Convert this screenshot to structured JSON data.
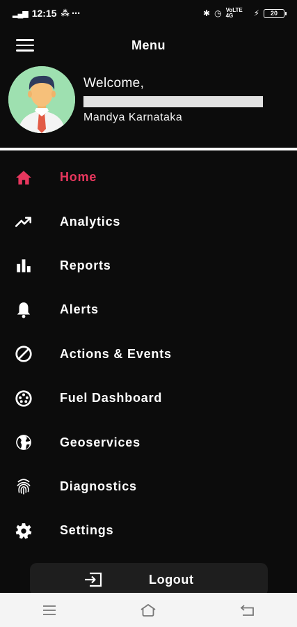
{
  "status_bar": {
    "signal": "4G",
    "time": "12:15",
    "extra": "⁂ ⋯",
    "network": "VoLTE 4G",
    "battery": "20"
  },
  "header": {
    "title": "Menu"
  },
  "profile": {
    "welcome": "Welcome,",
    "location": "Mandya Karnataka"
  },
  "nav": {
    "items": [
      {
        "label": "Home",
        "icon": "home-icon",
        "active": true
      },
      {
        "label": "Analytics",
        "icon": "trending-up-icon"
      },
      {
        "label": "Reports",
        "icon": "bar-chart-icon"
      },
      {
        "label": "Alerts",
        "icon": "bell-icon"
      },
      {
        "label": "Actions & Events",
        "icon": "block-icon"
      },
      {
        "label": "Fuel Dashboard",
        "icon": "gauge-icon"
      },
      {
        "label": "Geoservices",
        "icon": "globe-icon"
      },
      {
        "label": "Diagnostics",
        "icon": "fingerprint-icon"
      },
      {
        "label": "Settings",
        "icon": "gear-icon"
      }
    ]
  },
  "logout": {
    "label": "Logout"
  },
  "colors": {
    "background": "#0c0c0c",
    "accent": "#e8375e",
    "text": "#ffffff"
  }
}
